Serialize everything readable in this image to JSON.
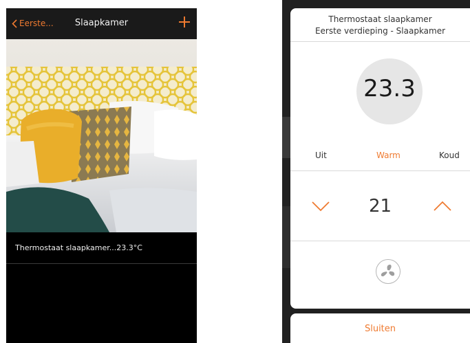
{
  "room_screen": {
    "back_label": "Eerste...",
    "title": "Slaapkamer",
    "add_icon": "plus-icon",
    "device_text": "Thermostaat slaapkamer...23.3°C"
  },
  "thermostat_dialog": {
    "title": "Thermostaat slaapkamer",
    "subtitle": "Eerste verdieping - Slaapkamer",
    "current_temperature": "23.3",
    "modes": [
      {
        "label": "Uit",
        "active": false
      },
      {
        "label": "Warm",
        "active": true
      },
      {
        "label": "Koud",
        "active": false
      }
    ],
    "setpoint": "21",
    "fan_icon": "fan-icon",
    "close_label": "Sluiten"
  },
  "colors": {
    "accent": "#ef7a30",
    "nav_background": "#1a1a1a",
    "screen_background": "#000000",
    "circle_background": "#e6e6e6"
  }
}
